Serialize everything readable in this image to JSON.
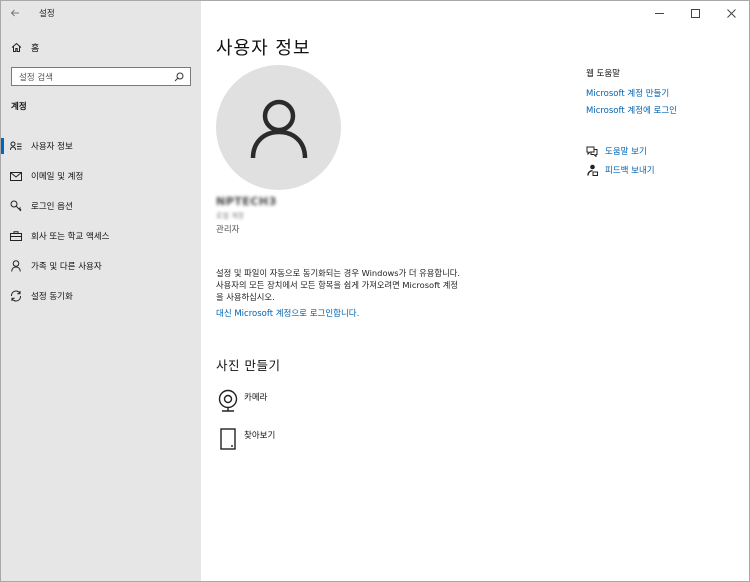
{
  "window": {
    "title": "설정"
  },
  "sidebar": {
    "home_label": "홈",
    "search_placeholder": "설정 검색",
    "section_label": "계정",
    "items": [
      {
        "label": "사용자 정보",
        "icon": "user-info-icon",
        "active": true
      },
      {
        "label": "이메일 및 계정",
        "icon": "mail-icon",
        "active": false
      },
      {
        "label": "로그인 옵션",
        "icon": "key-icon",
        "active": false
      },
      {
        "label": "회사 또는 학교 액세스",
        "icon": "briefcase-icon",
        "active": false
      },
      {
        "label": "가족 및 다른 사용자",
        "icon": "person-icon",
        "active": false
      },
      {
        "label": "설정 동기화",
        "icon": "sync-icon",
        "active": false
      }
    ]
  },
  "main": {
    "title": "사용자 정보",
    "username": "NPTECH3",
    "email": "로컬 계정",
    "role": "관리자",
    "description_lines": [
      "설정 및 파일이 자동으로 동기화되는 경우 Windows가 더 유용합니다.",
      "사용자의 모든 장치에서 모든 항목을 쉽게 가져오려면 Microsoft 계정",
      "을 사용하십시오."
    ],
    "ms_link": "대신 Microsoft 계정으로 로그인합니다.",
    "create_photo_title": "사진 만들기",
    "photo_options": [
      {
        "label": "카메라",
        "icon": "camera-icon"
      },
      {
        "label": "찾아보기",
        "icon": "browse-icon"
      }
    ]
  },
  "help": {
    "title": "웹 도움말",
    "links": [
      "Microsoft 계정 만들기",
      "Microsoft 계정에 로그인"
    ],
    "actions": [
      {
        "label": "도움말 보기",
        "icon": "help-chat-icon"
      },
      {
        "label": "피드백 보내기",
        "icon": "feedback-icon"
      }
    ]
  },
  "colors": {
    "accent": "#0067c0",
    "link": "#0063b1",
    "sidebar_bg": "#e6e6e6"
  }
}
